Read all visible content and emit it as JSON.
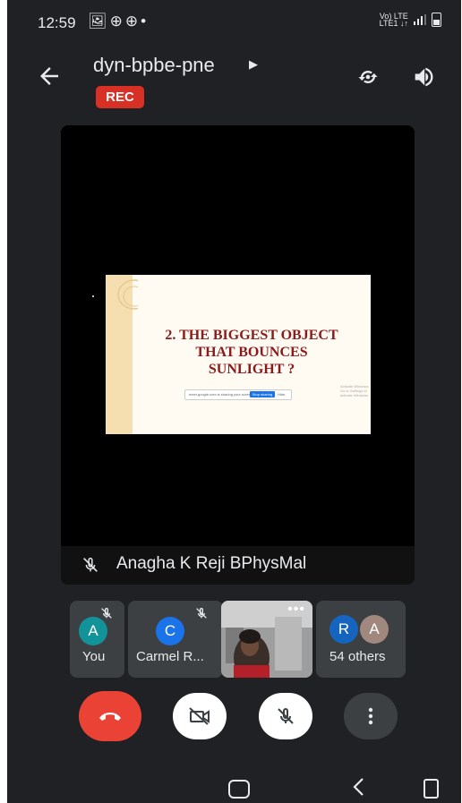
{
  "status_bar": {
    "time": "12:59",
    "notification_icons": [
      "image-icon",
      "app-icon",
      "app-icon",
      "dot-icon"
    ],
    "network": "Vo) LTE LTE1 ↓↑"
  },
  "header": {
    "meeting_code": "dyn-bpbe-pne",
    "rec_badge": "REC"
  },
  "presentation": {
    "slide_title": "2. THE BIGGEST OBJECT THAT BOUNCES SUNLIGHT ?",
    "slide_title_lines": [
      "2. THE BIGGEST OBJECT",
      "THAT BOUNCES",
      "SUNLIGHT ?"
    ],
    "presenter_name": "Anagha K Reji BPhysMal",
    "presenter_muted": true
  },
  "participants": [
    {
      "label": "You",
      "initial": "A",
      "color": "#12939a",
      "muted": true
    },
    {
      "label": "Carmel R...",
      "initial": "C",
      "color": "#1a73e8",
      "muted": true
    },
    {
      "label": "54 others",
      "initials": [
        "R",
        "A"
      ],
      "colors": [
        "#1565c0",
        "#a1887f"
      ]
    }
  ],
  "controls": [
    "end-call-icon",
    "camera-off-icon",
    "mic-off-icon",
    "more-options-icon"
  ],
  "colors": {
    "background": "#202124",
    "rec": "#d93025",
    "end_call": "#ea4335",
    "slide_text": "#8b1a1a"
  }
}
